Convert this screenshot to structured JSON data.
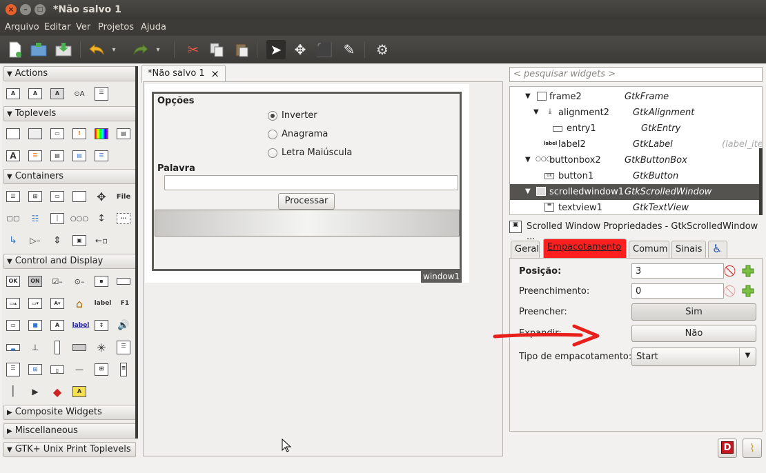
{
  "window": {
    "title": "*Não salvo 1",
    "controls": {
      "close": "×",
      "minimize": "–",
      "maximize": "□"
    }
  },
  "menu": [
    "Arquivo",
    "Editar",
    "Ver",
    "Projetos",
    "Ajuda"
  ],
  "palette": {
    "groups": [
      "Actions",
      "Toplevels",
      "Containers",
      "Control and Display",
      "Composite Widgets",
      "Miscellaneous",
      "GTK+ Unix Print Toplevels"
    ],
    "icon_texts": {
      "file": "File",
      "label": "label",
      "f1": "F1",
      "ok": "OK",
      "on": "ON",
      "label_blue": "label",
      "A": "A"
    }
  },
  "doc_tab": {
    "label": "*Não salvo 1",
    "close": "×"
  },
  "form": {
    "frame_label": "Opções",
    "radios": [
      {
        "label": "Inverter",
        "checked": true
      },
      {
        "label": "Anagrama",
        "checked": false
      },
      {
        "label": "Letra Maiúscula",
        "checked": false
      }
    ],
    "entry_label": "Palavra",
    "button": "Processar",
    "window_tag": "window1"
  },
  "search_placeholder": "< pesquisar widgets >",
  "tree": [
    {
      "name": "frame2",
      "type": "GtkFrame",
      "extra": ""
    },
    {
      "name": "alignment2",
      "type": "GtkAlignment",
      "extra": ""
    },
    {
      "name": "entry1",
      "type": "GtkEntry",
      "extra": ""
    },
    {
      "name": "label2",
      "type": "GtkLabel",
      "extra": "(label_iter"
    },
    {
      "name": "buttonbox2",
      "type": "GtkButtonBox",
      "extra": ""
    },
    {
      "name": "button1",
      "type": "GtkButton",
      "extra": ""
    },
    {
      "name": "scrolledwindow1",
      "type": "GtkScrolledWindow",
      "extra": ""
    },
    {
      "name": "textview1",
      "type": "GtkTextView",
      "extra": ""
    }
  ],
  "tree_icon_label": "label",
  "properties": {
    "title": "Scrolled Window Propriedades - GtkScrolledWindow ...",
    "tabs": [
      "Geral",
      "Empacotamento",
      "Comum",
      "Sinais"
    ],
    "active_tab": "Empacotamento",
    "rows": {
      "posicao": {
        "label": "Posição:",
        "value": "3"
      },
      "preenchimento": {
        "label": "Preenchimento:",
        "value": "0"
      },
      "preencher": {
        "label": "Preencher:",
        "value": "Sim"
      },
      "expandir": {
        "label": "Expandir:",
        "value": "Não"
      },
      "tipo": {
        "label": "Tipo de empacotamento:",
        "value": "Start"
      }
    }
  },
  "accent_colors": {
    "active_tab": "#ff1f1f",
    "arrow": "#e8201c",
    "selection": "#545350"
  }
}
